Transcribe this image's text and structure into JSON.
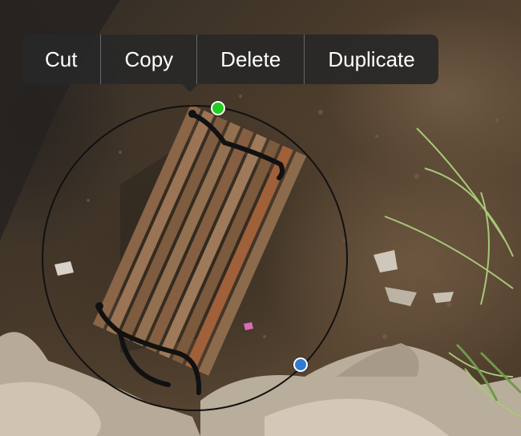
{
  "context_menu": {
    "items": [
      {
        "label": "Cut"
      },
      {
        "label": "Copy"
      },
      {
        "label": "Delete"
      },
      {
        "label": "Duplicate"
      }
    ]
  },
  "selection": {
    "shape": "circle",
    "handles": [
      "rotate-handle",
      "resize-handle"
    ]
  },
  "colors": {
    "menu_bg": "#282828",
    "menu_text": "#ffffff",
    "rotate_handle": "#22cc22",
    "resize_handle": "#2e7bd4",
    "selection_outline": "#111111"
  }
}
